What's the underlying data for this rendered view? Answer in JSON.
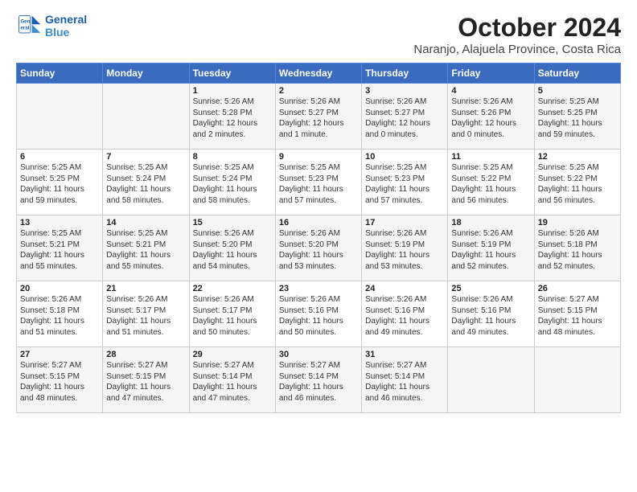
{
  "logo": {
    "line1": "General",
    "line2": "Blue"
  },
  "title": "October 2024",
  "subtitle": "Naranjo, Alajuela Province, Costa Rica",
  "headers": [
    "Sunday",
    "Monday",
    "Tuesday",
    "Wednesday",
    "Thursday",
    "Friday",
    "Saturday"
  ],
  "weeks": [
    [
      {
        "day": "",
        "info": ""
      },
      {
        "day": "",
        "info": ""
      },
      {
        "day": "1",
        "info": "Sunrise: 5:26 AM\nSunset: 5:28 PM\nDaylight: 12 hours\nand 2 minutes."
      },
      {
        "day": "2",
        "info": "Sunrise: 5:26 AM\nSunset: 5:27 PM\nDaylight: 12 hours\nand 1 minute."
      },
      {
        "day": "3",
        "info": "Sunrise: 5:26 AM\nSunset: 5:27 PM\nDaylight: 12 hours\nand 0 minutes."
      },
      {
        "day": "4",
        "info": "Sunrise: 5:26 AM\nSunset: 5:26 PM\nDaylight: 12 hours\nand 0 minutes."
      },
      {
        "day": "5",
        "info": "Sunrise: 5:25 AM\nSunset: 5:25 PM\nDaylight: 11 hours\nand 59 minutes."
      }
    ],
    [
      {
        "day": "6",
        "info": "Sunrise: 5:25 AM\nSunset: 5:25 PM\nDaylight: 11 hours\nand 59 minutes."
      },
      {
        "day": "7",
        "info": "Sunrise: 5:25 AM\nSunset: 5:24 PM\nDaylight: 11 hours\nand 58 minutes."
      },
      {
        "day": "8",
        "info": "Sunrise: 5:25 AM\nSunset: 5:24 PM\nDaylight: 11 hours\nand 58 minutes."
      },
      {
        "day": "9",
        "info": "Sunrise: 5:25 AM\nSunset: 5:23 PM\nDaylight: 11 hours\nand 57 minutes."
      },
      {
        "day": "10",
        "info": "Sunrise: 5:25 AM\nSunset: 5:23 PM\nDaylight: 11 hours\nand 57 minutes."
      },
      {
        "day": "11",
        "info": "Sunrise: 5:25 AM\nSunset: 5:22 PM\nDaylight: 11 hours\nand 56 minutes."
      },
      {
        "day": "12",
        "info": "Sunrise: 5:25 AM\nSunset: 5:22 PM\nDaylight: 11 hours\nand 56 minutes."
      }
    ],
    [
      {
        "day": "13",
        "info": "Sunrise: 5:25 AM\nSunset: 5:21 PM\nDaylight: 11 hours\nand 55 minutes."
      },
      {
        "day": "14",
        "info": "Sunrise: 5:25 AM\nSunset: 5:21 PM\nDaylight: 11 hours\nand 55 minutes."
      },
      {
        "day": "15",
        "info": "Sunrise: 5:26 AM\nSunset: 5:20 PM\nDaylight: 11 hours\nand 54 minutes."
      },
      {
        "day": "16",
        "info": "Sunrise: 5:26 AM\nSunset: 5:20 PM\nDaylight: 11 hours\nand 53 minutes."
      },
      {
        "day": "17",
        "info": "Sunrise: 5:26 AM\nSunset: 5:19 PM\nDaylight: 11 hours\nand 53 minutes."
      },
      {
        "day": "18",
        "info": "Sunrise: 5:26 AM\nSunset: 5:19 PM\nDaylight: 11 hours\nand 52 minutes."
      },
      {
        "day": "19",
        "info": "Sunrise: 5:26 AM\nSunset: 5:18 PM\nDaylight: 11 hours\nand 52 minutes."
      }
    ],
    [
      {
        "day": "20",
        "info": "Sunrise: 5:26 AM\nSunset: 5:18 PM\nDaylight: 11 hours\nand 51 minutes."
      },
      {
        "day": "21",
        "info": "Sunrise: 5:26 AM\nSunset: 5:17 PM\nDaylight: 11 hours\nand 51 minutes."
      },
      {
        "day": "22",
        "info": "Sunrise: 5:26 AM\nSunset: 5:17 PM\nDaylight: 11 hours\nand 50 minutes."
      },
      {
        "day": "23",
        "info": "Sunrise: 5:26 AM\nSunset: 5:16 PM\nDaylight: 11 hours\nand 50 minutes."
      },
      {
        "day": "24",
        "info": "Sunrise: 5:26 AM\nSunset: 5:16 PM\nDaylight: 11 hours\nand 49 minutes."
      },
      {
        "day": "25",
        "info": "Sunrise: 5:26 AM\nSunset: 5:16 PM\nDaylight: 11 hours\nand 49 minutes."
      },
      {
        "day": "26",
        "info": "Sunrise: 5:27 AM\nSunset: 5:15 PM\nDaylight: 11 hours\nand 48 minutes."
      }
    ],
    [
      {
        "day": "27",
        "info": "Sunrise: 5:27 AM\nSunset: 5:15 PM\nDaylight: 11 hours\nand 48 minutes."
      },
      {
        "day": "28",
        "info": "Sunrise: 5:27 AM\nSunset: 5:15 PM\nDaylight: 11 hours\nand 47 minutes."
      },
      {
        "day": "29",
        "info": "Sunrise: 5:27 AM\nSunset: 5:14 PM\nDaylight: 11 hours\nand 47 minutes."
      },
      {
        "day": "30",
        "info": "Sunrise: 5:27 AM\nSunset: 5:14 PM\nDaylight: 11 hours\nand 46 minutes."
      },
      {
        "day": "31",
        "info": "Sunrise: 5:27 AM\nSunset: 5:14 PM\nDaylight: 11 hours\nand 46 minutes."
      },
      {
        "day": "",
        "info": ""
      },
      {
        "day": "",
        "info": ""
      }
    ]
  ]
}
